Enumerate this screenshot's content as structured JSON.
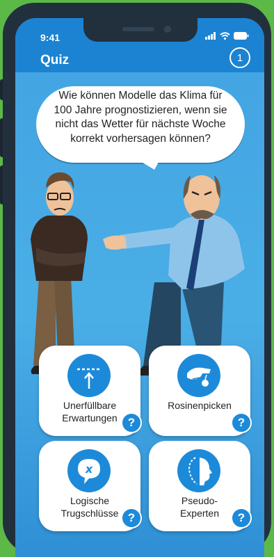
{
  "status_bar": {
    "time": "9:41"
  },
  "header": {
    "title": "Quiz",
    "question_number": "1"
  },
  "speech_bubble": {
    "lines": [
      "Wie können Modelle das Klima für",
      "100 Jahre prognostizieren, wenn sie",
      "nicht das Wetter für nächste Woche",
      "korrekt vorhersagen können?"
    ]
  },
  "answers": [
    {
      "line1": "Unerfüllbare",
      "line2": "Erwartungen",
      "icon": "unreachable-bar-icon",
      "help": "?"
    },
    {
      "line1": "",
      "line2": "Rosinenpicken",
      "icon": "cherry-picking-hand-icon",
      "help": "?"
    },
    {
      "line1": "Logische",
      "line2": "Trugschlüsse",
      "icon": "fallacy-speech-icon",
      "help": "?"
    },
    {
      "line1": "Pseudo-",
      "line2": "Experten",
      "icon": "pseudo-expert-face-icon",
      "help": "?"
    }
  ],
  "colors": {
    "background": "#5cb948",
    "phone_frame": "#22303d",
    "header": "#1b83d2",
    "screen": "#41a3e2",
    "accent": "#1d8ad9"
  }
}
